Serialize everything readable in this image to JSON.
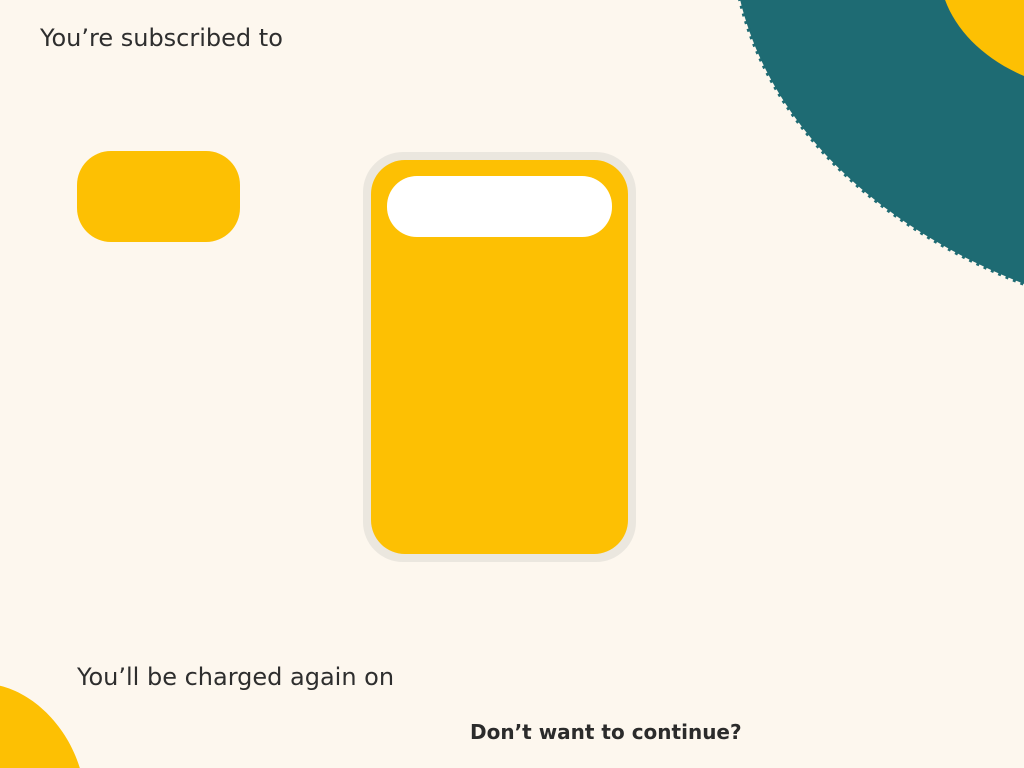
{
  "header": {
    "subscribed_label": "You’re subscribed to"
  },
  "billing": {
    "charged_label": "You’ll be charged again on"
  },
  "actions": {
    "cancel_prompt": "Don’t want to continue?"
  },
  "colors": {
    "background": "#fdf7ee",
    "accent_yellow": "#fdc003",
    "accent_teal": "#1e6b73",
    "card_frame": "#ebe7df",
    "text": "#2e2e2e"
  }
}
